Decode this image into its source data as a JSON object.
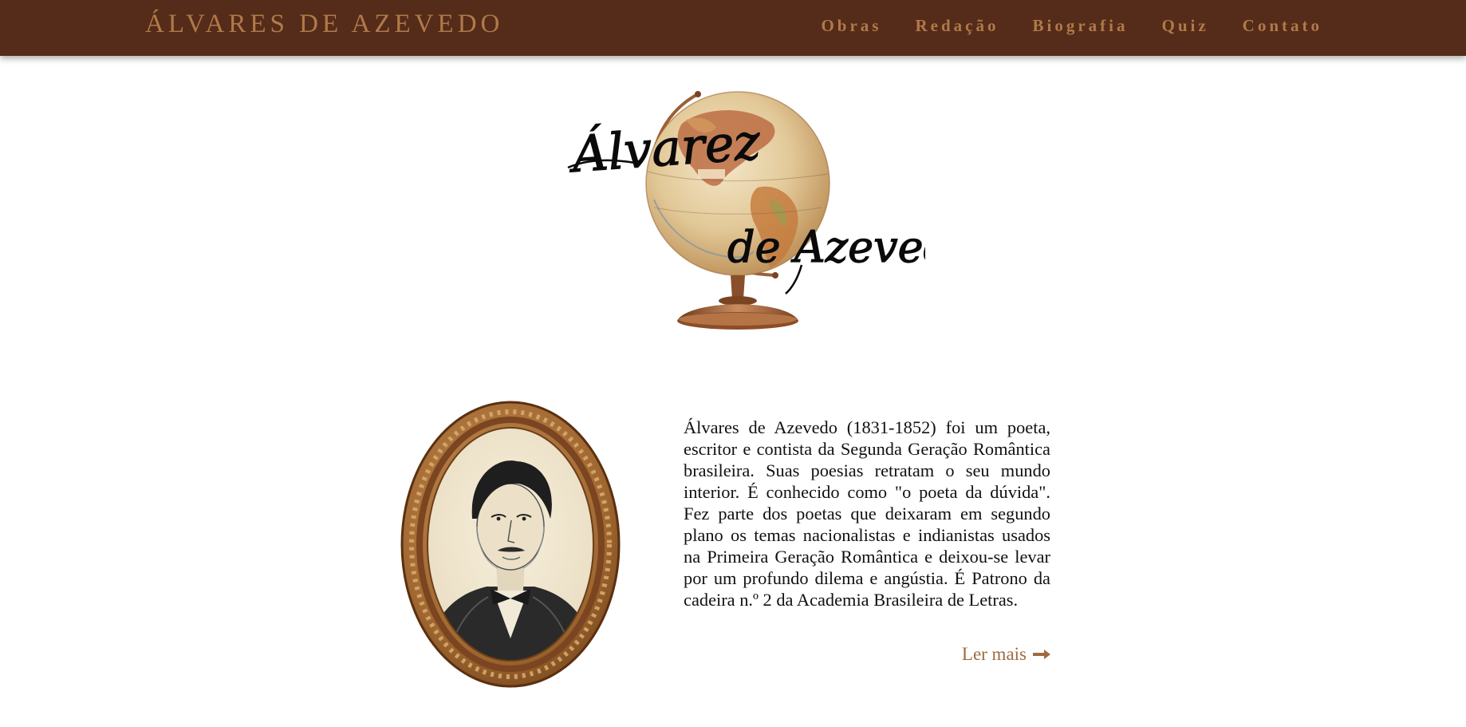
{
  "navbar": {
    "brand": "ÁLVARES DE AZEVEDO",
    "links": [
      "Obras",
      "Redação",
      "Biografia",
      "Quiz",
      "Contato"
    ]
  },
  "hero": {
    "logo_line1": "Álvarez",
    "logo_line2": "de Azevedo",
    "logo_icon": "globe-icon"
  },
  "bio": {
    "portrait_icon": "portrait-icon",
    "text": "Álvares de Azevedo (1831-1852) foi um poeta, escritor e contista da Segunda Geração Romântica brasileira. Suas poesias retratam o seu mundo interior. É conhecido como \"o poeta da dúvida\". Fez parte dos poetas que deixaram em segundo plano os temas nacionalistas e indianistas usados na Primeira Geração Romântica e deixou-se levar por um profundo dilema e angústia. É Patrono da cadeira n.º 2 da Academia Brasileira de Letras.",
    "read_more": "Ler mais",
    "read_more_icon": "arrow-right-icon"
  },
  "colors": {
    "navbar_bg": "#552b1a",
    "accent": "#b07a48",
    "link": "#9d6b3f"
  }
}
